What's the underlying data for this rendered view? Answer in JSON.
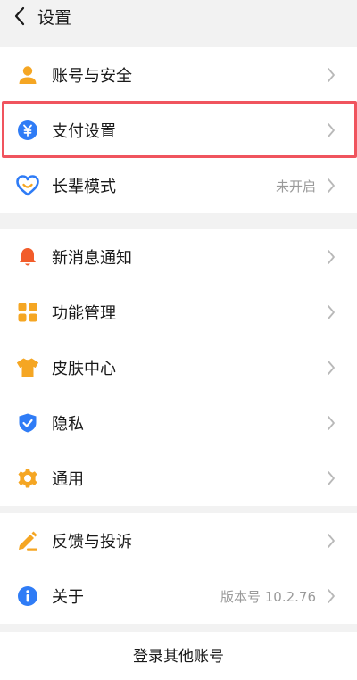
{
  "header": {
    "title": "设置",
    "back_icon": "chevron-left-icon"
  },
  "groups": [
    {
      "items": [
        {
          "label": "账号与安全",
          "icon": "person-icon",
          "value": ""
        },
        {
          "label": "支付设置",
          "icon": "yuan-icon",
          "value": ""
        },
        {
          "label": "长辈模式",
          "icon": "heart-face-icon",
          "value": "未开启"
        }
      ]
    },
    {
      "items": [
        {
          "label": "新消息通知",
          "icon": "bell-icon",
          "value": ""
        },
        {
          "label": "功能管理",
          "icon": "grid-icon",
          "value": ""
        },
        {
          "label": "皮肤中心",
          "icon": "tshirt-icon",
          "value": ""
        },
        {
          "label": "隐私",
          "icon": "shield-check-icon",
          "value": ""
        },
        {
          "label": "通用",
          "icon": "gear-icon",
          "value": ""
        }
      ]
    },
    {
      "items": [
        {
          "label": "反馈与投诉",
          "icon": "pen-icon",
          "value": ""
        },
        {
          "label": "关于",
          "icon": "info-icon",
          "value": "版本号 10.2.76"
        }
      ]
    }
  ],
  "bottom": {
    "label": "登录其他账号"
  },
  "colors": {
    "orange": "#f5a623",
    "blue": "#2f7cf6",
    "red_orange": "#f25c2a",
    "highlight": "#f0545e",
    "chevron": "#b8b8b8"
  }
}
